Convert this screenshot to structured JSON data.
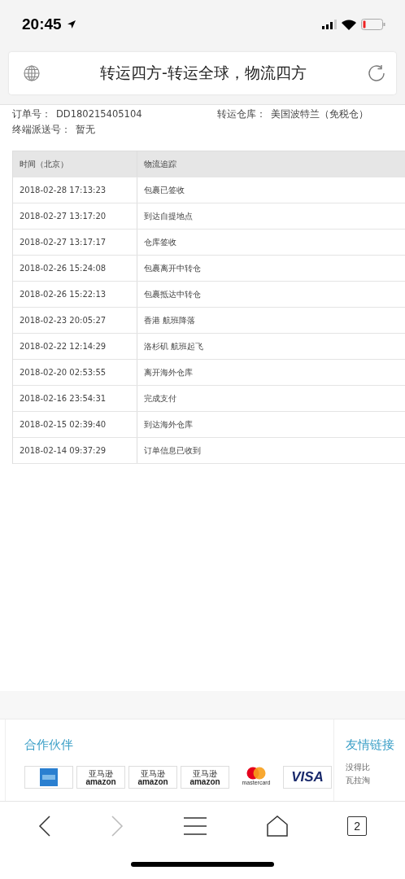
{
  "status_bar": {
    "time": "20:45"
  },
  "address_bar": {
    "title": "转运四方-转运全球，物流四方"
  },
  "order": {
    "order_label": "订单号：",
    "order_no": "DD180215405104",
    "warehouse_label": "转运仓库：",
    "warehouse": "美国波特兰（免税仓）",
    "delivery_label": "终端派送号：",
    "delivery_no": "暂无"
  },
  "table": {
    "columns": [
      "时间（北京）",
      "物流追踪"
    ],
    "rows": [
      [
        "2018-02-28 17:13:23",
        "包裹已签收"
      ],
      [
        "2018-02-27 13:17:20",
        "到达自提地点"
      ],
      [
        "2018-02-27 13:17:17",
        "仓库签收"
      ],
      [
        "2018-02-26 15:24:08",
        "包裹离开中转仓"
      ],
      [
        "2018-02-26 15:22:13",
        "包裹抵达中转仓"
      ],
      [
        "2018-02-23 20:05:27",
        "香港 航班降落"
      ],
      [
        "2018-02-22 12:14:29",
        "洛杉矶 航班起飞"
      ],
      [
        "2018-02-20 02:53:55",
        "离开海外仓库"
      ],
      [
        "2018-02-16 23:54:31",
        "完成支付"
      ],
      [
        "2018-02-15 02:39:40",
        "到达海外仓库"
      ],
      [
        "2018-02-14 09:37:29",
        "订单信息已收到"
      ]
    ]
  },
  "footer": {
    "partners_title": "合作伙伴",
    "partners": [
      {
        "kind": "amex"
      },
      {
        "kind": "amazon",
        "label": "亚马逊",
        "wordmark": "amazon"
      },
      {
        "kind": "amazon",
        "label": "亚马逊",
        "wordmark": "amazon"
      },
      {
        "kind": "amazon",
        "label": "亚马逊",
        "wordmark": "amazon"
      },
      {
        "kind": "mastercard",
        "wordmark": "mastercard"
      },
      {
        "kind": "visa",
        "wordmark": "VISA"
      }
    ],
    "links_title": "友情链接",
    "links": [
      "没得比",
      "瓦拉淘"
    ]
  },
  "toolbar": {
    "tab_count": "2"
  }
}
